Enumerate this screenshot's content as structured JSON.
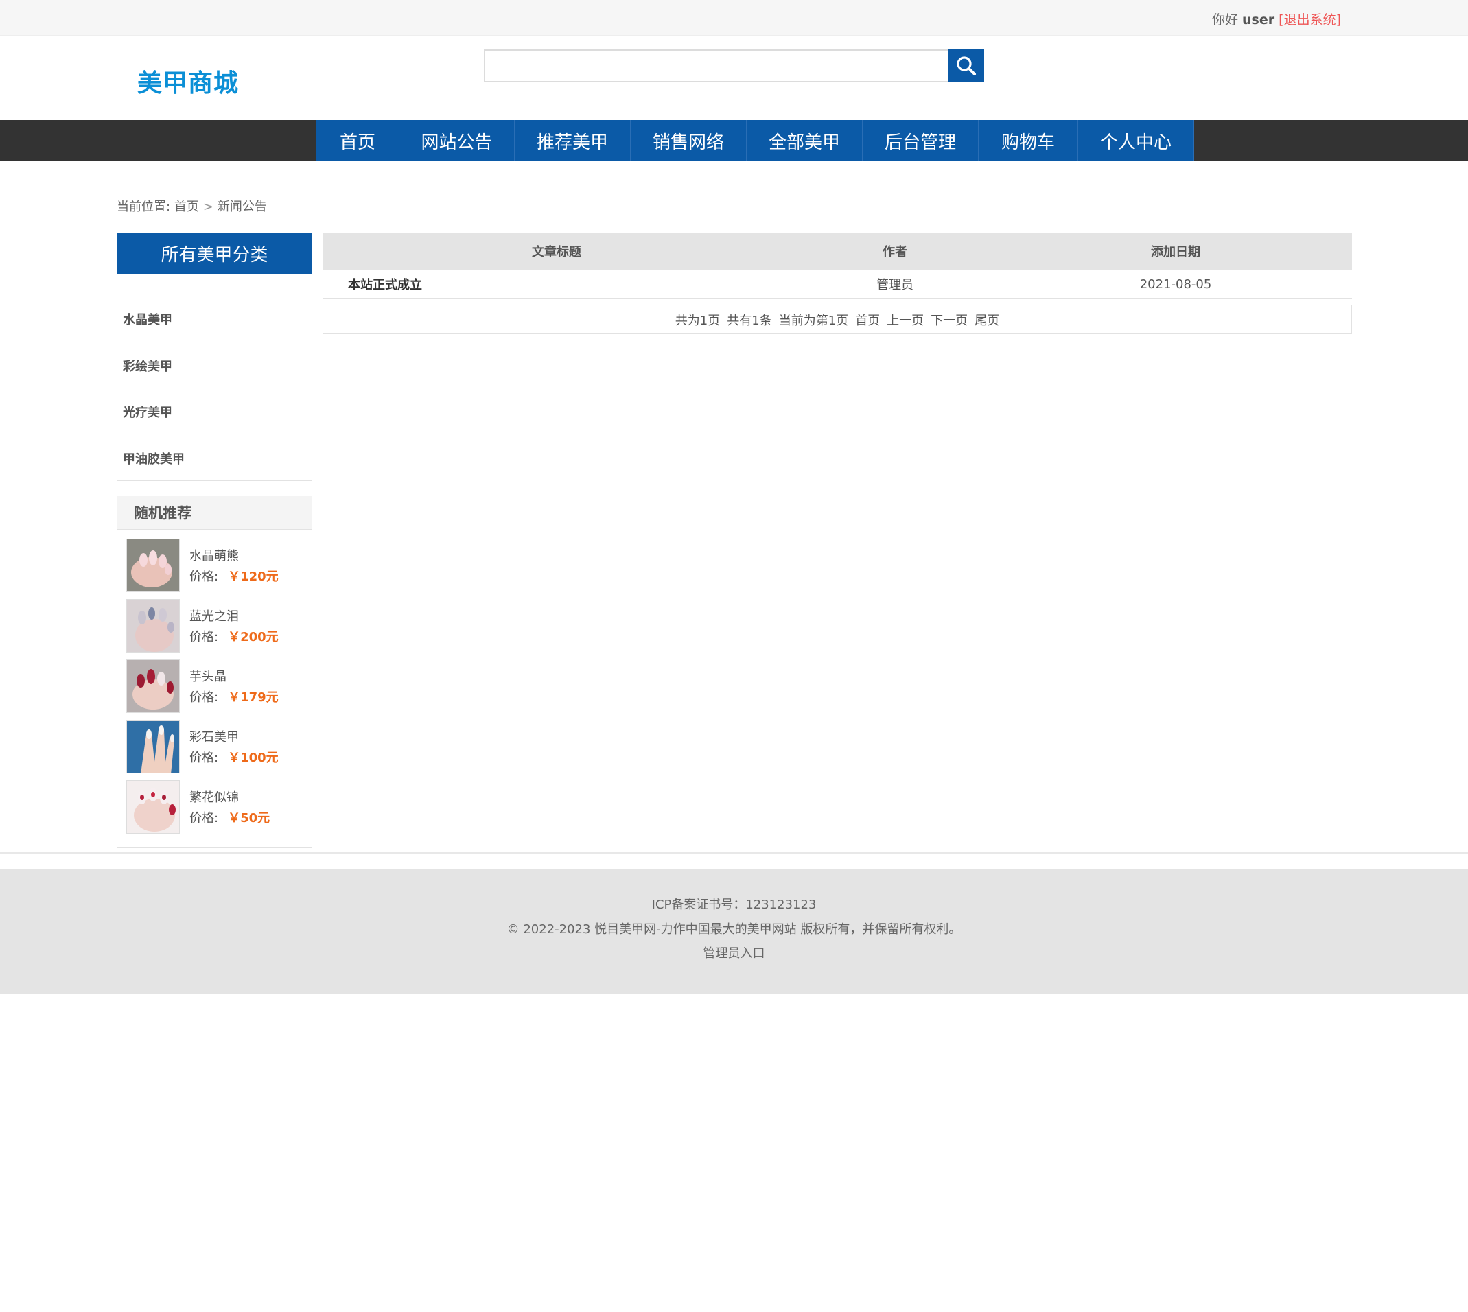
{
  "topbar": {
    "hello": "你好",
    "user": "user",
    "logout": "[退出系统]"
  },
  "logo": "美甲商城",
  "search": {
    "placeholder": ""
  },
  "nav": [
    {
      "label": "首页"
    },
    {
      "label": "网站公告"
    },
    {
      "label": "推荐美甲"
    },
    {
      "label": "销售网络"
    },
    {
      "label": "全部美甲"
    },
    {
      "label": "后台管理"
    },
    {
      "label": "购物车"
    },
    {
      "label": "个人中心"
    }
  ],
  "breadcrumb": {
    "prefix": "当前位置:",
    "home": "首页",
    "sep": ">",
    "current": "新闻公告"
  },
  "categories": {
    "title": "所有美甲分类",
    "items": [
      "水晶美甲",
      "彩绘美甲",
      "光疗美甲",
      "甲油胶美甲"
    ]
  },
  "random": {
    "title": "随机推荐",
    "price_label": "价格:",
    "items": [
      {
        "name": "水晶萌熊",
        "price": "￥120元"
      },
      {
        "name": "蓝光之泪",
        "price": "￥200元"
      },
      {
        "name": "芋头晶",
        "price": "￥179元"
      },
      {
        "name": "彩石美甲",
        "price": "￥100元"
      },
      {
        "name": "繁花似锦",
        "price": "￥50元"
      }
    ]
  },
  "articles": {
    "headers": [
      "文章标题",
      "作者",
      "添加日期"
    ],
    "rows": [
      {
        "title": "本站正式成立",
        "author": "管理员",
        "date": "2021-08-05"
      }
    ]
  },
  "pager": [
    "共为1页",
    "共有1条",
    "当前为第1页",
    "首页",
    "上一页",
    "下一页",
    "尾页"
  ],
  "footer": {
    "icp": "ICP备案证书号：123123123",
    "copyright": "© 2022-2023 悦目美甲网-力作中国最大的美甲网站 版权所有，并保留所有权利。",
    "admin": "管理员入口"
  },
  "colors": {
    "brand": "#0b5aa7",
    "nav_bg": "#333333",
    "logo": "#0b8fd6",
    "price": "#ee6a1a",
    "logout": "#ee5555"
  }
}
